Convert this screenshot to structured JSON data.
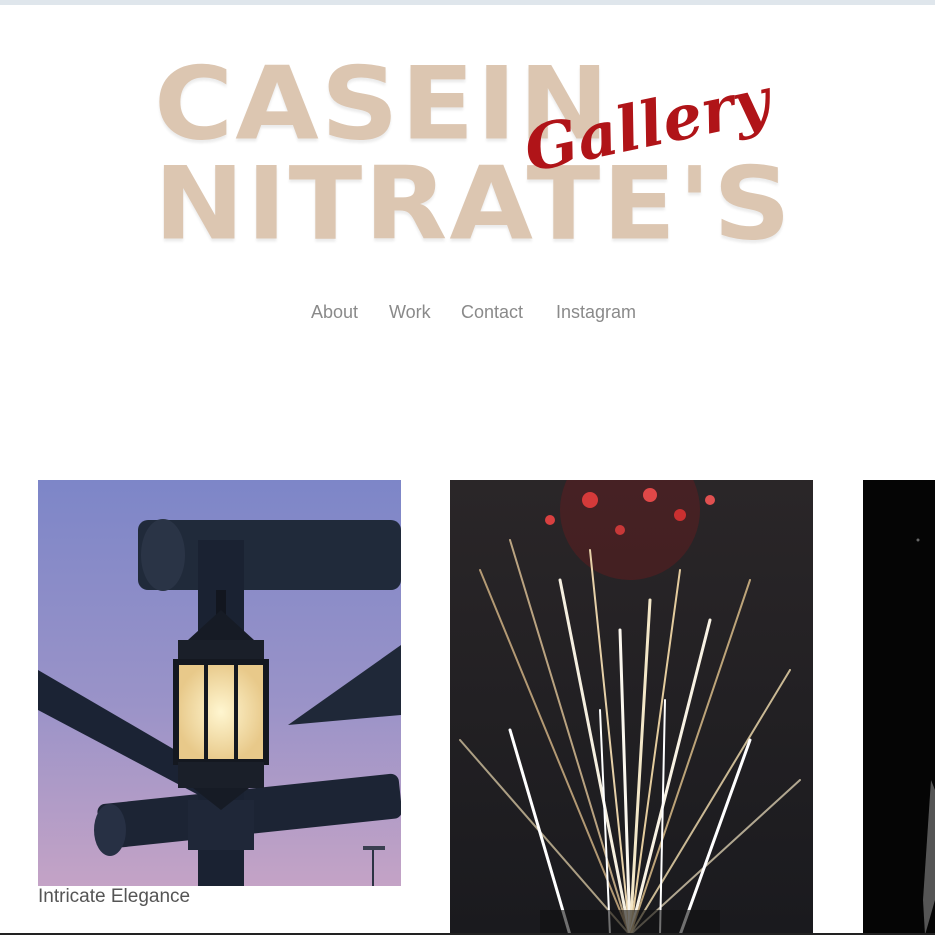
{
  "logo": {
    "line1": "CASEIN",
    "line2": "NITRATE'S",
    "script": "Gallery",
    "colors": {
      "block": "#dcc6b1",
      "script": "#b01418"
    }
  },
  "nav": {
    "items": [
      {
        "label": "About"
      },
      {
        "label": "Work"
      },
      {
        "label": "Contact"
      },
      {
        "label": "Instagram"
      }
    ]
  },
  "gallery": {
    "items": [
      {
        "caption": "Intricate Elegance",
        "image": "lantern-photo"
      },
      {
        "caption": "",
        "image": "fireworks-photo"
      },
      {
        "caption": "",
        "image": "dark-photo"
      }
    ]
  },
  "colors": {
    "nav_text": "#8a8a8a",
    "caption_text": "#555555",
    "top_bar": "#dfe6ec"
  }
}
